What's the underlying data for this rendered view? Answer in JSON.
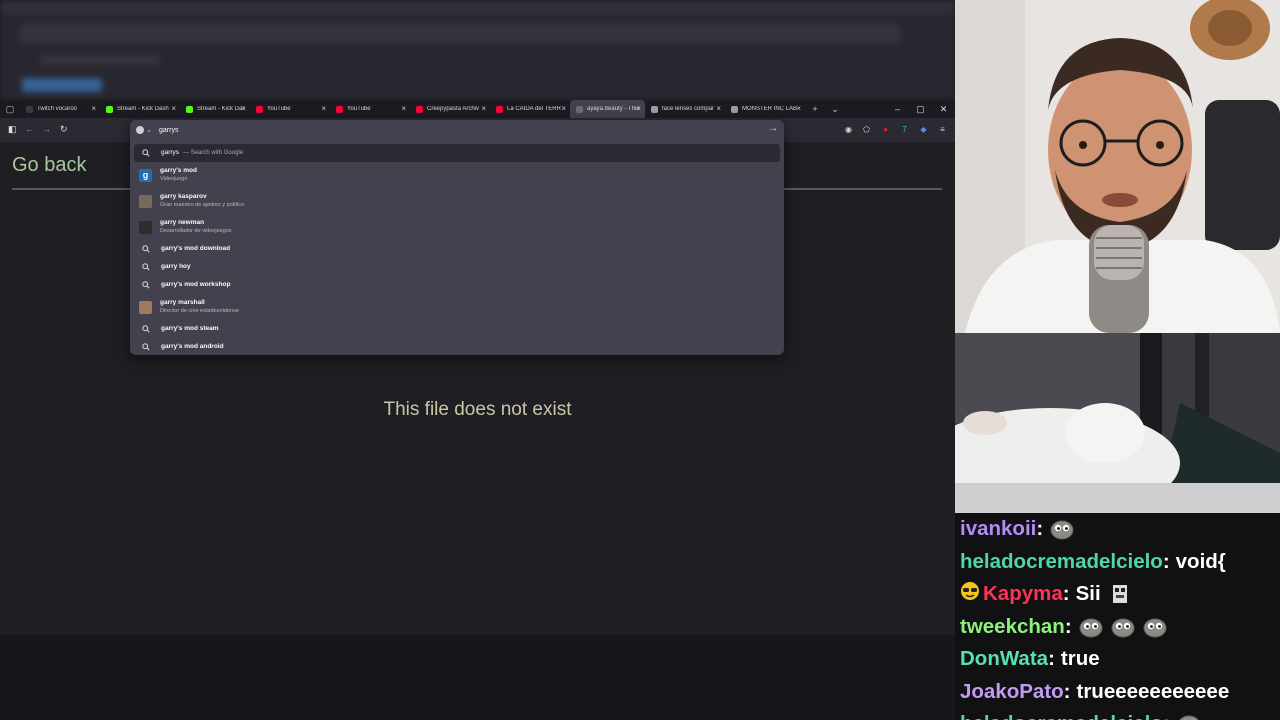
{
  "browser": {
    "tabs": [
      {
        "title": "Twitch vocaroo",
        "favicon_color": "#3a3942"
      },
      {
        "title": "Stream - Kick Dash",
        "favicon_color": "#53fc18"
      },
      {
        "title": "Stream - Kick Dash",
        "favicon_color": "#53fc18"
      },
      {
        "title": "YouTube",
        "favicon_color": "#ff0033"
      },
      {
        "title": "YouTube",
        "favicon_color": "#ff0033"
      },
      {
        "title": "Creepypasta Archiv",
        "favicon_color": "#ff0033"
      },
      {
        "title": "La CAÍDA del TERR",
        "favicon_color": "#ff0033"
      },
      {
        "title": "ayaya.beauty - This",
        "favicon_color": "#6b6b75",
        "active": true
      },
      {
        "title": "face lenses compar",
        "favicon_color": "#9a9aa2"
      },
      {
        "title": "MONSTER INC LAB",
        "favicon_color": "#9a9aa2"
      }
    ],
    "url_value": "garrys",
    "suggestions": [
      {
        "main": "garrys",
        "hint": "— Search with Google",
        "icon": "search-icon",
        "selected": true
      },
      {
        "main": "garry's mod",
        "sub": "Videojuego",
        "thumb_color": "#1f6fb8",
        "thumb_letter": "g"
      },
      {
        "main": "garry kasparov",
        "sub": "Gran maestro de ajedrez y político",
        "thumb_color": "#7a6a5a"
      },
      {
        "main": "garry newman",
        "sub": "Desarrollador de videojuegos",
        "thumb_color": "#2d2d2d"
      },
      {
        "main": "garry's mod download",
        "icon": "search-icon"
      },
      {
        "main": "garry hoy",
        "icon": "search-icon"
      },
      {
        "main": "garry's mod workshop",
        "icon": "search-icon"
      },
      {
        "main": "garry marshall",
        "sub": "Director de cine estadounidense",
        "thumb_color": "#a07a60"
      },
      {
        "main": "garry's mod steam",
        "icon": "search-icon"
      },
      {
        "main": "garry's mod android",
        "icon": "search-icon"
      }
    ]
  },
  "page": {
    "go_back": "Go back",
    "message": "This file does not exist"
  },
  "chat": [
    {
      "user": "ivankoii",
      "user_color": "#b58cf5",
      "sep": ":",
      "msg": "",
      "emotes": 1
    },
    {
      "user": "heladocremadelcielo",
      "user_color": "#4fd6a6",
      "sep": ":",
      "msg": "void{",
      "emotes": 0
    },
    {
      "user": "Kapyma",
      "user_color": "#ff3355",
      "sep": ":",
      "msg": "Sii",
      "emotes": 1,
      "badge": true
    },
    {
      "user": "tweekchan",
      "user_color": "#8ef27a",
      "sep": ":",
      "msg": "",
      "emotes": 3
    },
    {
      "user": "DonWata",
      "user_color": "#58e0b5",
      "sep": ":",
      "msg": "true",
      "emotes": 0
    },
    {
      "user": "JoakoPato",
      "user_color": "#c39cf2",
      "sep": ":",
      "msg": "trueeeeeeeeeee",
      "emotes": 0
    },
    {
      "user": "heladocremadelcielo",
      "user_color": "#4fd6a6",
      "sep": ":",
      "msg": "",
      "emotes": 1
    }
  ]
}
